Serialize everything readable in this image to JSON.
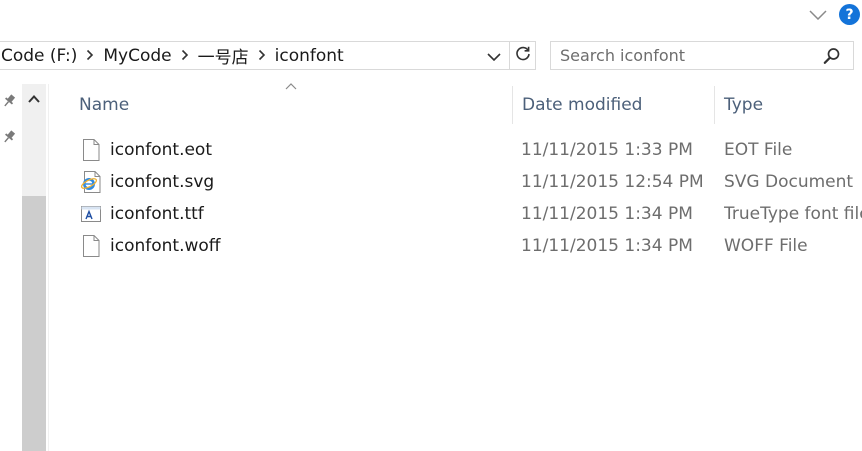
{
  "help": {
    "label": "?"
  },
  "breadcrumb": {
    "items": [
      "Code (F:)",
      "MyCode",
      "一号店",
      "iconfont"
    ]
  },
  "search": {
    "placeholder": "Search iconfont",
    "value": ""
  },
  "columns": {
    "name": "Name",
    "date_modified": "Date modified",
    "type": "Type"
  },
  "files": [
    {
      "name": "iconfont.eot",
      "date": "11/11/2015 1:33 PM",
      "type": "EOT File",
      "icon": "blank-document-icon"
    },
    {
      "name": "iconfont.svg",
      "date": "11/11/2015 12:54 PM",
      "type": "SVG Document",
      "icon": "internet-explorer-document-icon"
    },
    {
      "name": "iconfont.ttf",
      "date": "11/11/2015 1:34 PM",
      "type": "TrueType font file",
      "icon": "truetype-font-icon"
    },
    {
      "name": "iconfont.woff",
      "date": "11/11/2015 1:34 PM",
      "type": "WOFF File",
      "icon": "blank-document-icon"
    }
  ],
  "colors": {
    "accent": "#1373d9",
    "header_text": "#4c607a",
    "secondary_text": "#6d6d6d",
    "border": "#d9d9d9",
    "scrollbar_track": "#f0f0f0",
    "scrollbar_thumb": "#cdcdcd"
  }
}
